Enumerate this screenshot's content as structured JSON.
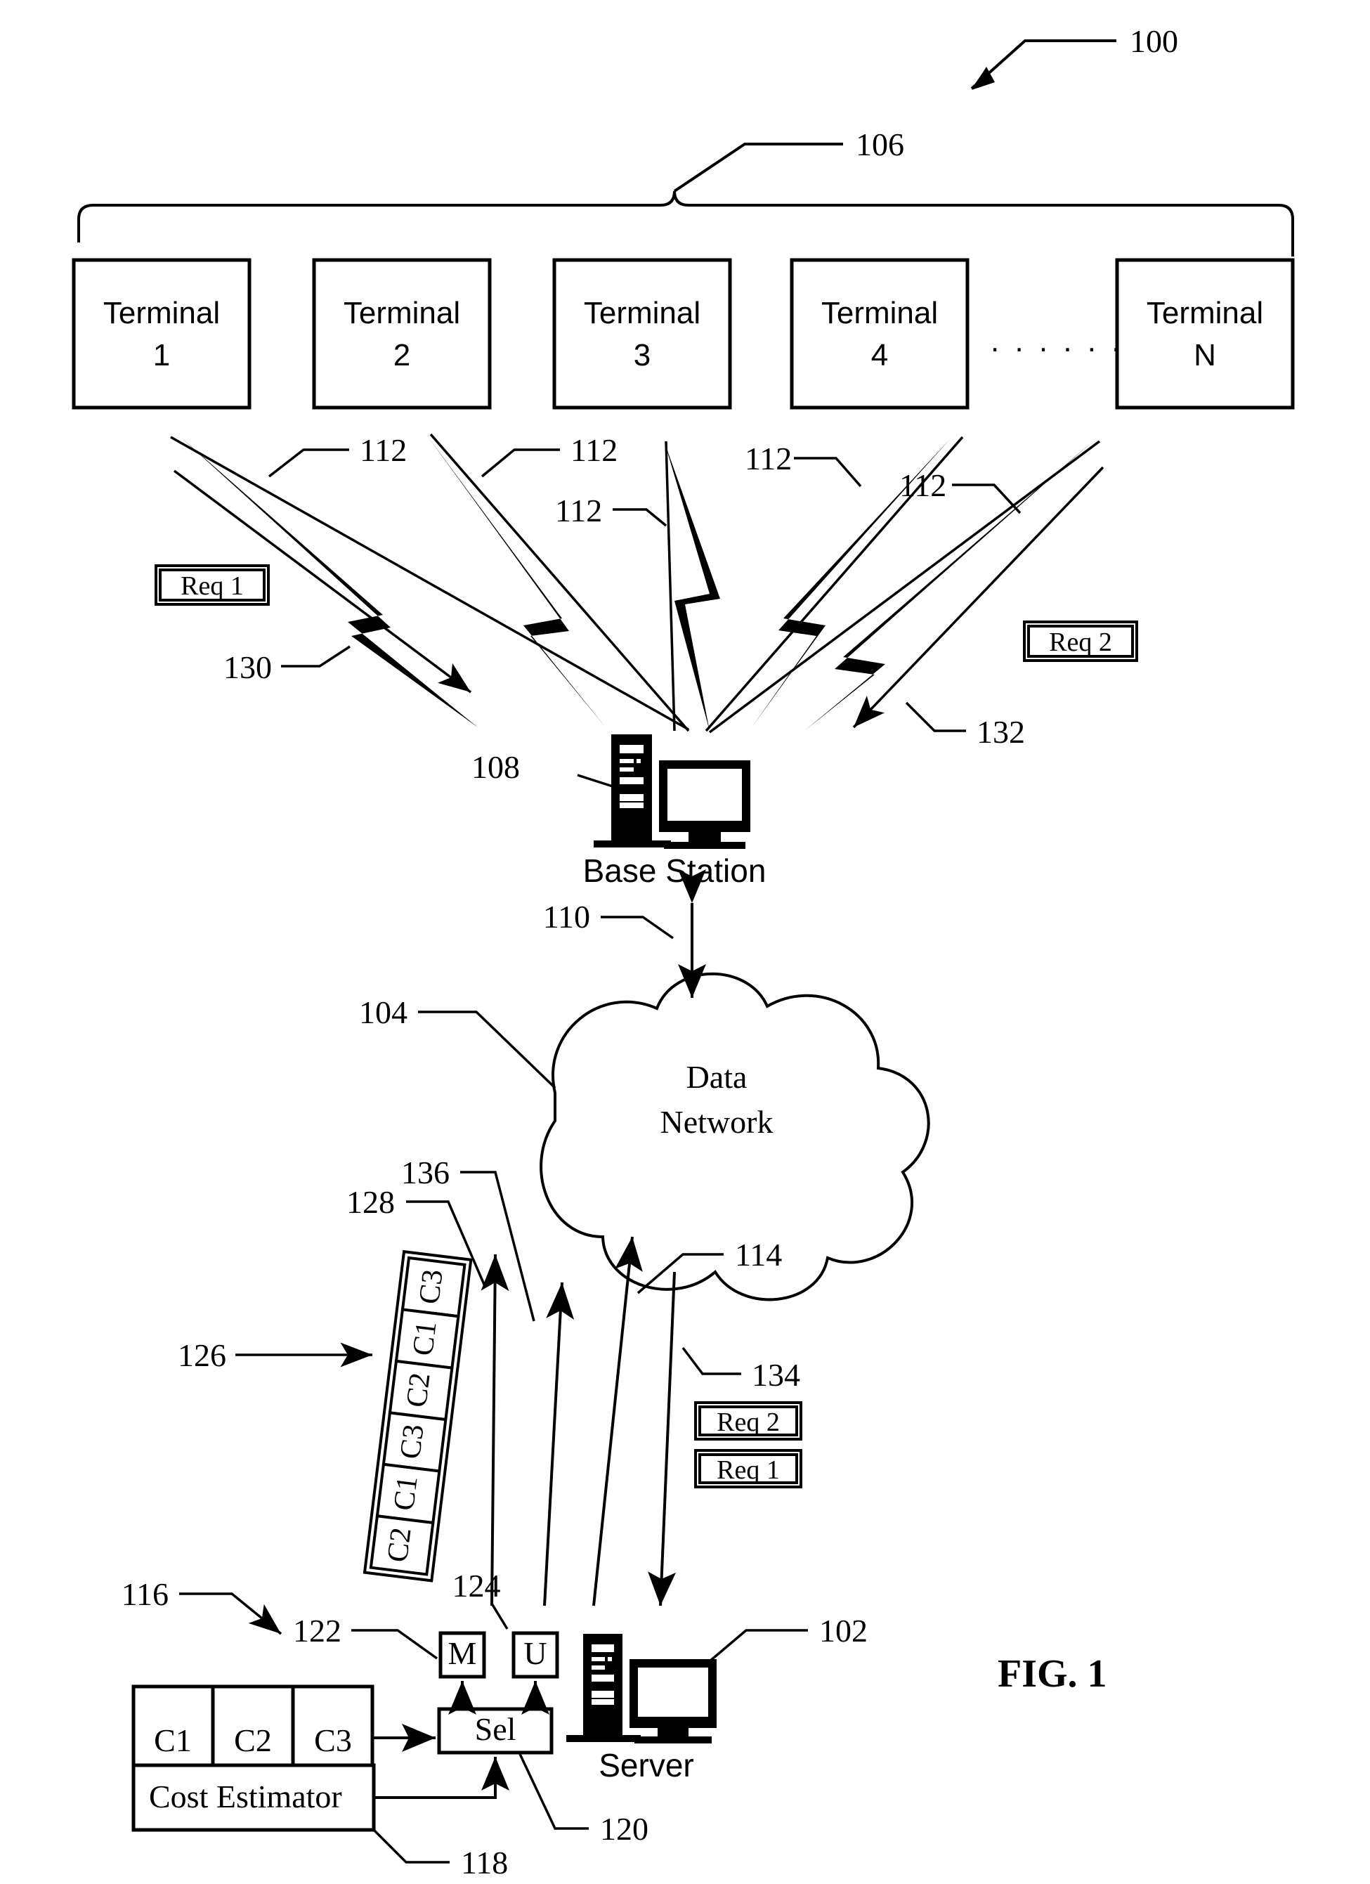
{
  "figure": {
    "title": "FIG. 1",
    "overall_ref": "100"
  },
  "terminals": {
    "group_ref": "106",
    "ellipsis": ". . . . . . . .",
    "items": [
      {
        "line1": "Terminal",
        "line2": "1"
      },
      {
        "line1": "Terminal",
        "line2": "2"
      },
      {
        "line1": "Terminal",
        "line2": "3"
      },
      {
        "line1": "Terminal",
        "line2": "4"
      },
      {
        "line1": "Terminal",
        "line2": "N"
      }
    ]
  },
  "wireless": {
    "link_refs": [
      "112",
      "112",
      "112",
      "112",
      "112"
    ],
    "req1_label": "Req 1",
    "req1_ref": "130",
    "req2_label": "Req 2",
    "req2_ref": "132"
  },
  "base_station": {
    "label": "Base Station",
    "ref": "108",
    "link_ref": "110"
  },
  "network": {
    "line1": "Data",
    "line2": "Network",
    "ref": "104"
  },
  "queue": {
    "ref": "126",
    "cells_top_to_bottom": [
      "C3",
      "C1",
      "C2",
      "C3",
      "C1",
      "C2"
    ],
    "arrow_refs": [
      "128",
      "136"
    ]
  },
  "scheduler": {
    "group_ref": "116",
    "classes": [
      "C1",
      "C2",
      "C3"
    ],
    "sel_label": "Sel",
    "sel_ref": "120",
    "m_label": "M",
    "m_ref": "122",
    "u_label": "U",
    "u_ref": "124",
    "cost_estimator_label": "Cost Estimator",
    "cost_estimator_ref": "118"
  },
  "server": {
    "label": "Server",
    "ref": "102",
    "downlink_ref": "114",
    "response_ref": "134",
    "req2_label": "Req 2",
    "req1_label": "Req 1"
  }
}
